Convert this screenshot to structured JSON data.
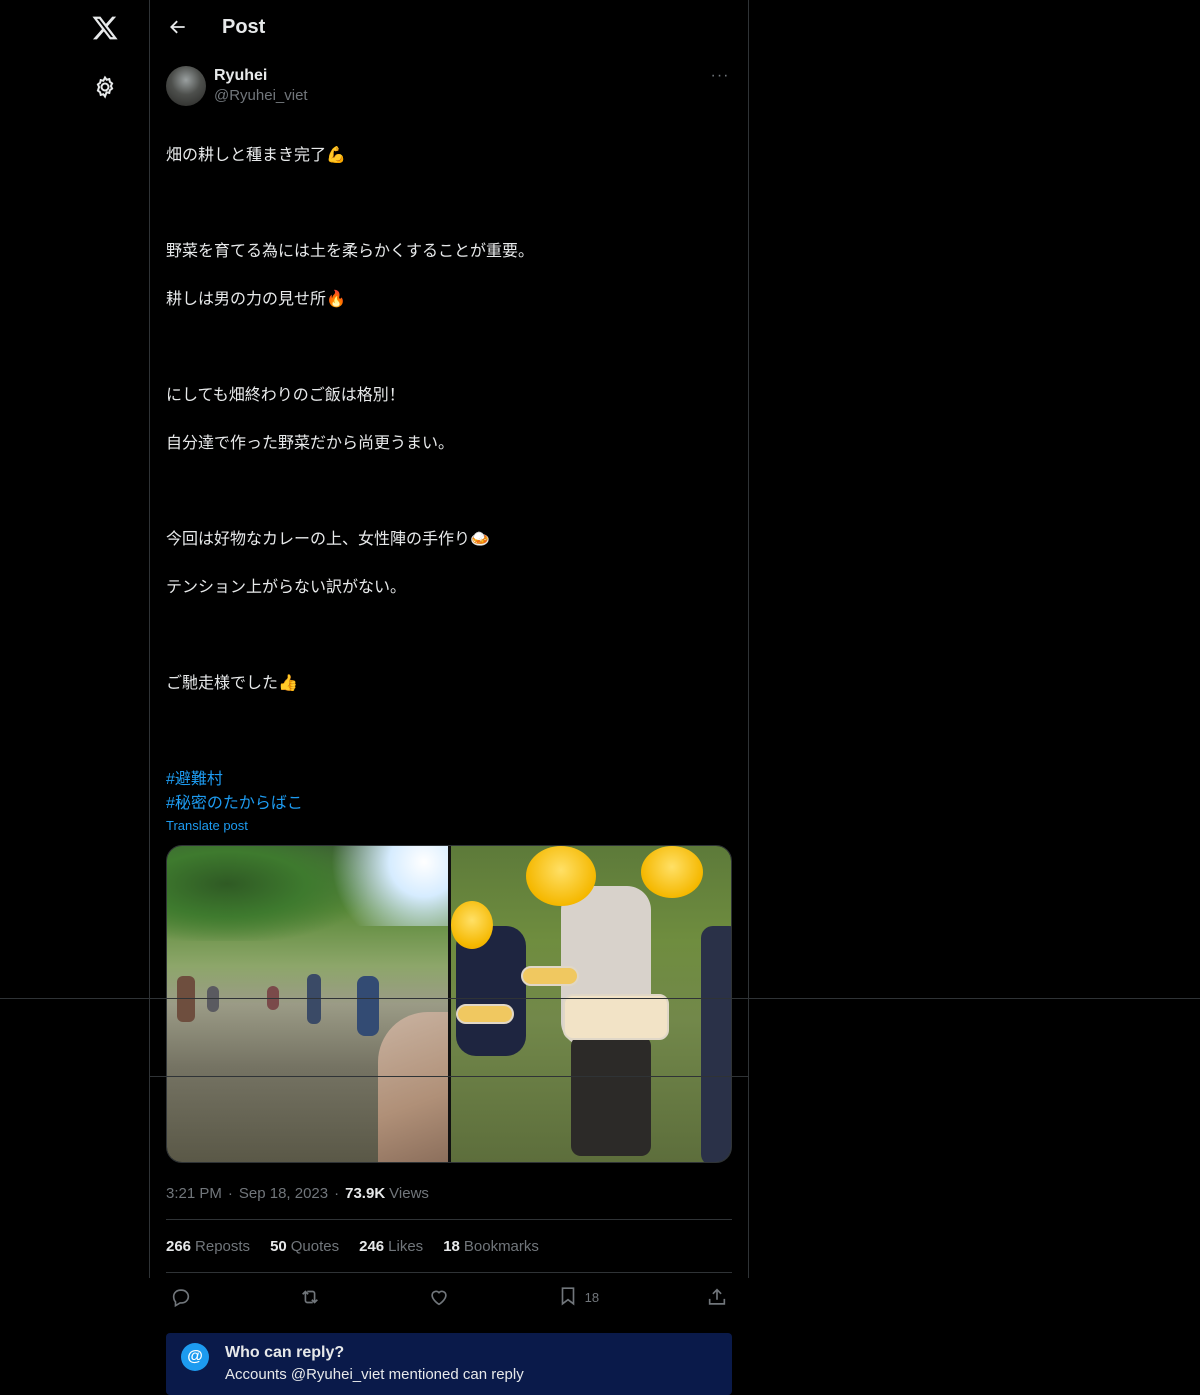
{
  "nav": {
    "logo_icon": "x-logo-icon",
    "settings_icon": "gear-icon"
  },
  "header": {
    "title": "Post"
  },
  "post": {
    "author": {
      "name": "Ryuhei",
      "handle": "@Ryuhei_viet"
    },
    "lines": [
      "畑の耕しと種まき完了💪",
      "",
      "野菜を育てる為には土を柔らかくすることが重要。",
      "耕しは男の力の見せ所🔥",
      "",
      "にしても畑終わりのご飯は格別！",
      "自分達で作った野菜だから尚更うまい。",
      "",
      "今回は好物なカレーの上、女性陣の手作り🍛",
      "テンション上がらない訳がない。",
      "",
      "ご馳走様でした👍",
      ""
    ],
    "hashtags": [
      "#避難村",
      "#秘密のたからばこ"
    ],
    "translate": "Translate post",
    "meta": {
      "time": "3:21 PM",
      "date": "Sep 18, 2023",
      "views": "73.9K",
      "views_label": "Views"
    },
    "stats": [
      {
        "num": "266",
        "label": "Reposts"
      },
      {
        "num": "50",
        "label": "Quotes"
      },
      {
        "num": "246",
        "label": "Likes"
      },
      {
        "num": "18",
        "label": "Bookmarks"
      }
    ],
    "actions": {
      "bookmark_count": "18"
    },
    "reply_box": {
      "title": "Who can reply?",
      "subtitle": "Accounts @Ryuhei_viet mentioned can reply",
      "icon": "@"
    }
  }
}
